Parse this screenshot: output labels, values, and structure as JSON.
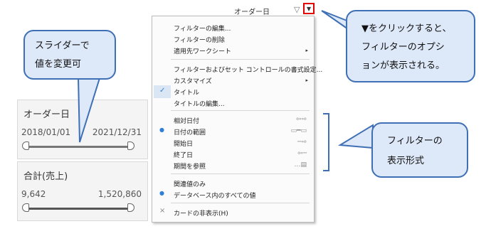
{
  "cards": {
    "order_date": {
      "title": "オーダー日",
      "min": "2018/01/01",
      "max": "2021/12/31"
    },
    "sales_sum": {
      "title": "合計(売上)",
      "min": "9,642",
      "max": "1,520,860"
    }
  },
  "callouts": {
    "slider": {
      "line1": "スライダーで",
      "line2": "値を変更可"
    },
    "dropdown": {
      "line1": "▼をクリックすると、",
      "line2": "フィルターのオプシ",
      "line3": "ョンが表示される。"
    },
    "format": {
      "line1": "フィルターの",
      "line2": "表示形式"
    }
  },
  "filter_header": {
    "title": "オーダー日",
    "funnel_icon": "▽",
    "dropdown_icon": "▾"
  },
  "menu": {
    "items": [
      {
        "label": "フィルターの編集..."
      },
      {
        "label": "フィルターの削除"
      },
      {
        "label": "適用先ワークシート",
        "submenu": "▸"
      },
      {
        "label": "フィルターおよびセット コントロールの書式設定..."
      },
      {
        "label": "カスタマイズ",
        "submenu": "▸"
      },
      {
        "label": "タイトル",
        "check": "✓"
      },
      {
        "label": "タイトルの編集..."
      },
      {
        "label": "相対日付"
      },
      {
        "label": "日付の範囲",
        "bullet": "●"
      },
      {
        "label": "開始日"
      },
      {
        "label": "終了日"
      },
      {
        "label": "期間を参照"
      },
      {
        "label": "関連値のみ"
      },
      {
        "label": "データベース内のすべての値",
        "bullet": "●"
      },
      {
        "label": "カードの非表示(H)",
        "close": "×"
      }
    ]
  },
  "colors": {
    "accent_red": "#e00000",
    "callout_border": "#3f6fb5",
    "callout_fill": "#dde8f8",
    "check_blue": "#2f7fd8"
  }
}
